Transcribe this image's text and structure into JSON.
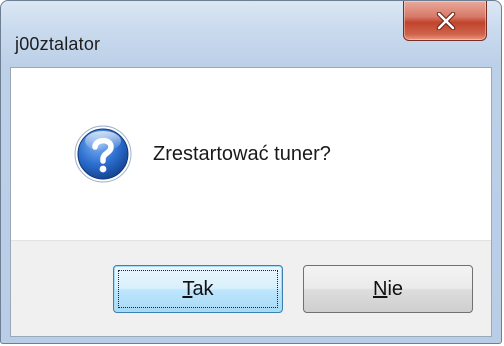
{
  "window": {
    "title": "j00ztalator",
    "close_icon": "close-icon"
  },
  "dialog": {
    "icon": "question-icon",
    "message": "Zrestartować tuner?"
  },
  "buttons": {
    "yes": {
      "mnemonic": "T",
      "rest": "ak",
      "default": true
    },
    "no": {
      "mnemonic": "N",
      "rest": "ie",
      "default": false
    }
  },
  "colors": {
    "close_button": "#c1442d",
    "icon_blue": "#1f5fb4",
    "default_button_border": "#3c7fb1"
  }
}
